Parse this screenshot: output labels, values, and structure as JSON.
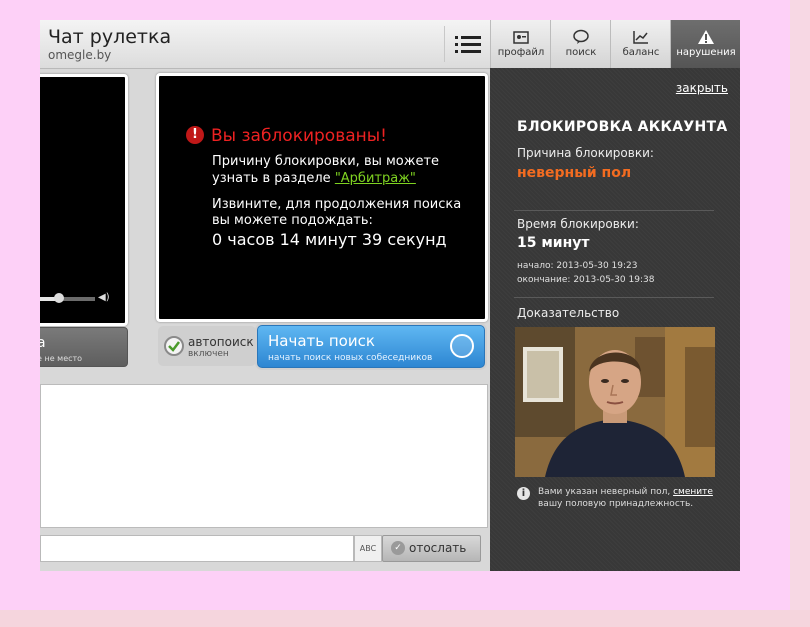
{
  "header": {
    "title": "Чат рулетка",
    "subtitle": "omegle.by"
  },
  "tabs": [
    {
      "label": "профайл",
      "icon": "profile-icon"
    },
    {
      "label": "поиск",
      "icon": "chat-bubble-icon"
    },
    {
      "label": "баланс",
      "icon": "chart-icon"
    },
    {
      "label": "нарушения",
      "icon": "warning-icon"
    }
  ],
  "panel": {
    "close": "закрыть",
    "heading": "БЛОКИРОВКА АККАУНТА",
    "reason_label": "Причина блокировки:",
    "reason_value": "неверный пол",
    "time_label": "Время блокировки:",
    "time_value": "15 минут",
    "start": "начало: 2013-05-30 19:23",
    "end": "окончание: 2013-05-30 19:38",
    "evidence_label": "Доказательство",
    "info_text": "Вами указан неверный пол,",
    "info_link": "смените",
    "info_text2": "вашу половую принадлежность."
  },
  "video": {
    "error_title": "Вы заблокированы!",
    "line1": "Причину блокировки, вы можете",
    "line2": "узнать в разделе",
    "link": "\"Арбитраж\"",
    "line3": "Извините, для продолжения поиска",
    "line4": "вы можете подождать:",
    "timer": "0 часов 14 минут 39 секунд"
  },
  "left_button": {
    "label": "а",
    "sub": "е не место"
  },
  "autosearch": {
    "label": "автопоиск",
    "state": "включен"
  },
  "start_search": {
    "label": "Начать поиск",
    "sub": "начать поиск новых собеседников"
  },
  "composer": {
    "spell": "ABC",
    "send": "отослать"
  },
  "colors": {
    "accent_orange": "#f36c21",
    "error_red": "#e22222",
    "link_green": "#7fd321",
    "button_blue": "#2d86d2"
  }
}
